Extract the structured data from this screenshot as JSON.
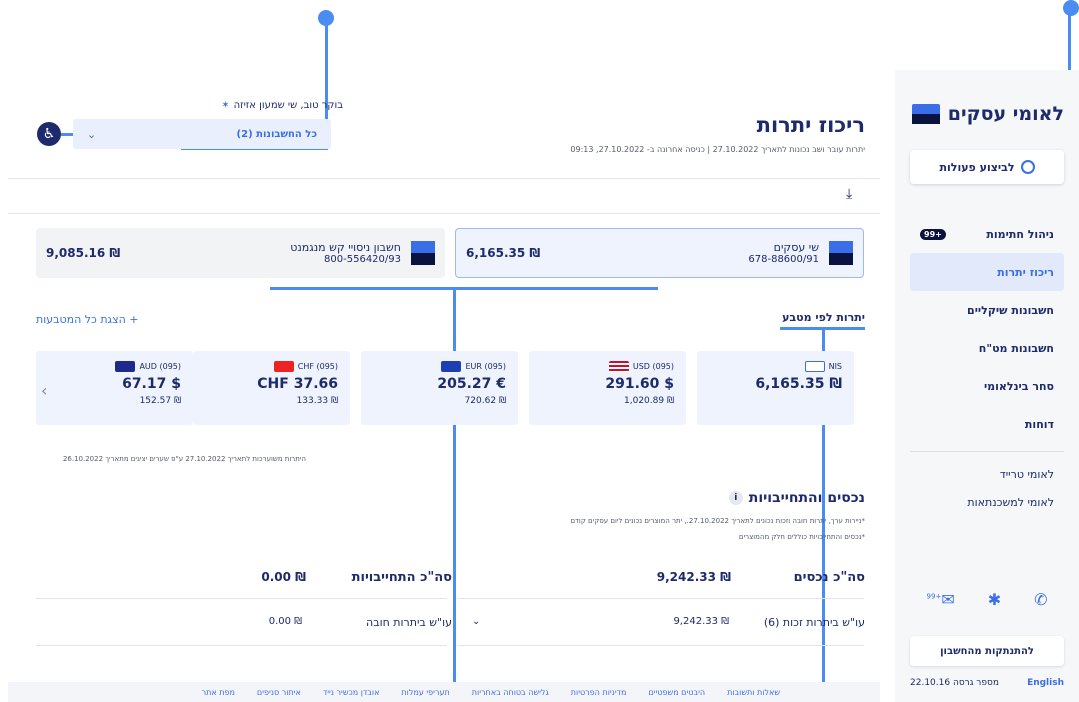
{
  "sidebar": {
    "logo": "לאומי עסקים",
    "action_button": "לביצוע פעולות",
    "nav": [
      {
        "label": "ניהול חתימות",
        "badge": "+99",
        "active": false
      },
      {
        "label": "ריכוז יתרות",
        "active": true
      },
      {
        "label": "חשבונות שיקליים",
        "active": false
      },
      {
        "label": "חשבונות מט\"ח",
        "active": false
      },
      {
        "label": "סחר בינלאומי",
        "active": false
      },
      {
        "label": "דוחות",
        "active": false
      }
    ],
    "sub_links": [
      "לאומי טרייד",
      "לאומי למשכנתאות"
    ],
    "icons": {
      "messages_badge": "+99"
    },
    "logout": "להתנתקות מהחשבון",
    "english": "English",
    "version": "מספר גרסה 22.10.16"
  },
  "header": {
    "greeting": "בוקר טוב, שי שמעון אזיזה",
    "account_select": "כל החשבונות (2)",
    "title": "ריכוז יתרות",
    "subtitle": "יתרות עובר ושב נכונות לתאריך 27.10.2022 | כניסה אחרונה ב- 27.10.2022, 09:13"
  },
  "accounts": [
    {
      "name": "שי עסקים",
      "number": "678-88600/91",
      "amount": "₪ 6,165.35"
    },
    {
      "name": "חשבון ניסויי קש מנגמנט",
      "number": "800-556420/93",
      "amount": "₪ 9,085.16"
    }
  ],
  "currency_section": {
    "title": "יתרות לפי מטבע",
    "show_all": "+ הצגת כל המטבעות",
    "cards": [
      {
        "code": "NIS",
        "amount": "₪ 6,165.35",
        "sub": "",
        "flag": "il"
      },
      {
        "code": "USD (095)",
        "amount": "$ 291.60",
        "sub": "₪ 1,020.89",
        "flag": "us"
      },
      {
        "code": "EUR (095)",
        "amount": "€ 205.27",
        "sub": "₪ 720.62",
        "flag": "eu"
      },
      {
        "code": "CHF (095)",
        "amount": "CHF 37.66",
        "sub": "₪ 133.33",
        "flag": "ch"
      },
      {
        "code": "AUD (095)",
        "amount": "$ 67.17",
        "sub": "₪ 152.57",
        "flag": "au"
      }
    ],
    "rates_note": "היתרות משוערכות לתאריך 27.10.2022 ע\"פ שערים יציגים מתאריך 26.10.2022"
  },
  "assets": {
    "title": "נכסים והתחייבויות",
    "note1": "*ניירות ערך, יתרות חובה וזכות נכונים לתאריך 27.10.2022., יתר המוצרים נכונים ליום עסקים קודם",
    "note2": "*נכסים והתחייבויות כוללים חלק מהמוצרים",
    "total_assets_label": "סה\"כ נכסים",
    "total_assets_value": "₪ 9,242.33",
    "total_liab_label": "סה\"כ התחייבויות",
    "total_liab_value": "₪ 0.00",
    "credit_label": "עו\"ש ביתרות זכות (6)",
    "credit_value": "₪ 9,242.33",
    "debit_label": "עו\"ש ביתרות חובה",
    "debit_value": "₪ 0.00"
  },
  "footer": [
    "שאלות ותשובות",
    "היבטים משפטיים",
    "מדיניות הפרטיות",
    "גלישה בטוחה באחריות",
    "תעריפי עמלות",
    "אובדן מכשיר נייד",
    "איתור סניפים",
    "מפת אתר"
  ],
  "colors": {
    "accent": "#3a6ee8",
    "navy": "#1d2a6b",
    "annotation": "#4a8cf0"
  }
}
